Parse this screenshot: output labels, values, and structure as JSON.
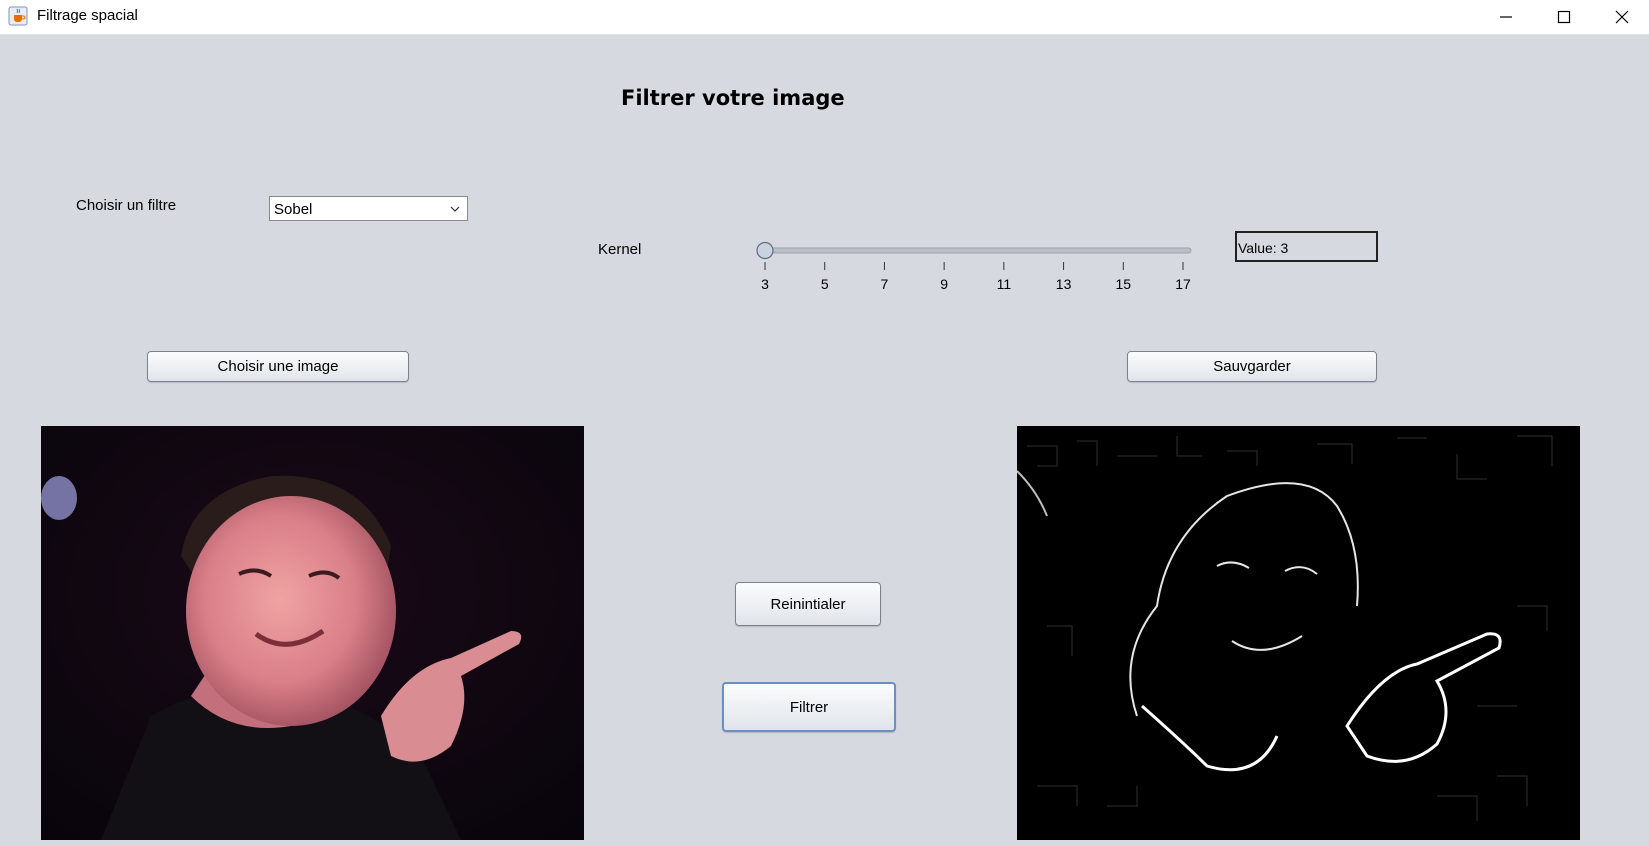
{
  "window": {
    "title": "Filtrage spacial",
    "icon": "java-cup-icon",
    "controls": [
      "minimize-icon",
      "maximize-icon",
      "close-icon"
    ]
  },
  "heading": "Filtrer votre image",
  "filter": {
    "label": "Choisir un filtre",
    "selected": "Sobel"
  },
  "kernel": {
    "label": "Kernel",
    "min": 3,
    "max": 17,
    "value": 3,
    "ticks": [
      "3",
      "5",
      "7",
      "9",
      "11",
      "13",
      "15",
      "17"
    ],
    "value_label": "Value: 3"
  },
  "buttons": {
    "choose_image": "Choisir une image",
    "save": "Sauvgarder",
    "reset": "Reinintialer",
    "filter": "Filtrer"
  },
  "images": {
    "original": "photo of a smiling man pointing",
    "filtered": "Sobel edge-detection result of the photo"
  },
  "colors": {
    "background": "#d6d9e0",
    "image_background": "#000000"
  }
}
